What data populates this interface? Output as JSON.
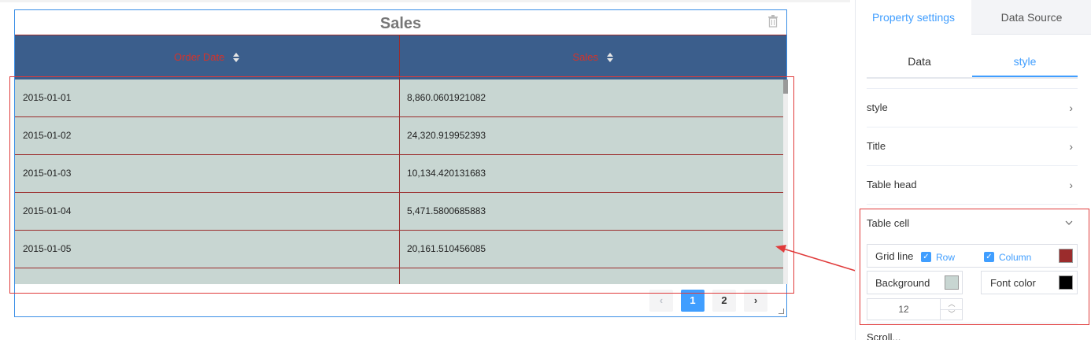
{
  "widget": {
    "title": "Sales",
    "columns": [
      "Order Date",
      "Sales"
    ],
    "rows": [
      [
        "2015-01-01",
        "8,860.0601921082"
      ],
      [
        "2015-01-02",
        "24,320.919952393"
      ],
      [
        "2015-01-03",
        "10,134.420131683"
      ],
      [
        "2015-01-04",
        "5,471.5800685883"
      ],
      [
        "2015-01-05",
        "20,161.510456085"
      ]
    ],
    "pagination": {
      "prev": "‹",
      "pages": [
        "1",
        "2"
      ],
      "current": "1",
      "next": "›"
    }
  },
  "panel": {
    "top_tabs": [
      "Property settings",
      "Data Source"
    ],
    "active_top_tab": "Property settings",
    "sub_tabs": [
      "Data",
      "style"
    ],
    "active_sub_tab": "style",
    "sections": [
      "style",
      "Title",
      "Table head",
      "Table cell"
    ],
    "table_cell": {
      "grid_line_label": "Grid line",
      "row_label": "Row",
      "column_label": "Column",
      "row_checked": true,
      "column_checked": true,
      "grid_color": "#9b2c2c",
      "background_label": "Background",
      "background_color": "#c8d6d2",
      "font_color_label": "Font color",
      "font_color": "#000000",
      "font_size": "12"
    },
    "partial_label": "Scroll..."
  },
  "colors": {
    "header_bg": "#3b5e8c",
    "header_text": "#d4332a",
    "cell_bg": "#c8d6d2",
    "accent": "#409eff",
    "highlight": "#e03b3b"
  },
  "icons": [
    "trash-icon",
    "sort-icon",
    "chevron-right-icon",
    "chevron-down-icon",
    "check-icon",
    "resize-icon"
  ]
}
